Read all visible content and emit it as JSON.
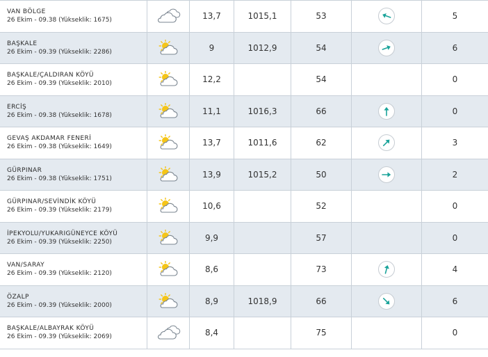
{
  "rows": [
    {
      "name": "VAN BÖLGE",
      "meta": "26 Ekim - 09.38 (Yükseklik: 1675)",
      "icon": "cloudy-icon",
      "temp": "13,7",
      "pressure": "1015,1",
      "humidity": "53",
      "wind_dir": "wind-direction-icon",
      "wind_angle": 110,
      "wind_speed": "5"
    },
    {
      "name": "BAŞKALE",
      "meta": "26 Ekim - 09.39 (Yükseklik: 2286)",
      "icon": "partly-cloudy-icon",
      "temp": "9",
      "pressure": "1012,9",
      "humidity": "54",
      "wind_dir": "wind-direction-icon",
      "wind_angle": 250,
      "wind_speed": "6"
    },
    {
      "name": "BAŞKALE/ÇALDIRAN KÖYÜ",
      "meta": "26 Ekim - 09.39 (Yükseklik: 2010)",
      "icon": "partly-cloudy-icon",
      "temp": "12,2",
      "pressure": "",
      "humidity": "54",
      "wind_dir": "",
      "wind_angle": null,
      "wind_speed": "0"
    },
    {
      "name": "ERCİŞ",
      "meta": "26 Ekim - 09.38 (Yükseklik: 1678)",
      "icon": "partly-cloudy-icon",
      "temp": "11,1",
      "pressure": "1016,3",
      "humidity": "66",
      "wind_dir": "wind-direction-icon",
      "wind_angle": 180,
      "wind_speed": "0"
    },
    {
      "name": "GEVAŞ AKDAMAR FENERİ",
      "meta": "26 Ekim - 09.38 (Yükseklik: 1649)",
      "icon": "partly-cloudy-icon",
      "temp": "13,7",
      "pressure": "1011,6",
      "humidity": "62",
      "wind_dir": "wind-direction-icon",
      "wind_angle": 225,
      "wind_speed": "3"
    },
    {
      "name": "GÜRPINAR",
      "meta": "26 Ekim - 09.38 (Yükseklik: 1751)",
      "icon": "partly-cloudy-icon",
      "temp": "13,9",
      "pressure": "1015,2",
      "humidity": "50",
      "wind_dir": "wind-direction-icon",
      "wind_angle": 270,
      "wind_speed": "2"
    },
    {
      "name": "GÜRPINAR/SEVİNDİK KÖYÜ",
      "meta": "26 Ekim - 09.39 (Yükseklik: 2179)",
      "icon": "partly-cloudy-icon",
      "temp": "10,6",
      "pressure": "",
      "humidity": "52",
      "wind_dir": "",
      "wind_angle": null,
      "wind_speed": "0"
    },
    {
      "name": "İPEKYOLU/YUKARIGÜNEYCE KÖYÜ",
      "meta": "26 Ekim - 09.39 (Yükseklik: 2250)",
      "icon": "partly-cloudy-icon",
      "temp": "9,9",
      "pressure": "",
      "humidity": "57",
      "wind_dir": "",
      "wind_angle": null,
      "wind_speed": "0"
    },
    {
      "name": "VAN/SARAY",
      "meta": "26 Ekim - 09.39 (Yükseklik: 2120)",
      "icon": "partly-cloudy-icon",
      "temp": "8,6",
      "pressure": "",
      "humidity": "73",
      "wind_dir": "wind-direction-icon",
      "wind_angle": 195,
      "wind_speed": "4"
    },
    {
      "name": "ÖZALP",
      "meta": "26 Ekim - 09.39 (Yükseklik: 2000)",
      "icon": "partly-cloudy-icon",
      "temp": "8,9",
      "pressure": "1018,9",
      "humidity": "66",
      "wind_dir": "wind-direction-icon",
      "wind_angle": 315,
      "wind_speed": "6"
    },
    {
      "name": "BAŞKALE/ALBAYRAK KÖYÜ",
      "meta": "26 Ekim - 09.39 (Yükseklik: 2069)",
      "icon": "cloudy-icon",
      "temp": "8,4",
      "pressure": "",
      "humidity": "75",
      "wind_dir": "",
      "wind_angle": null,
      "wind_speed": "0"
    }
  ],
  "colors": {
    "row_alt": "#e4eaf0",
    "border": "#c8d0d8",
    "wind_arrow": "#1aa39a",
    "sun": "#f5c518",
    "cloud_stroke": "#7a8590"
  }
}
